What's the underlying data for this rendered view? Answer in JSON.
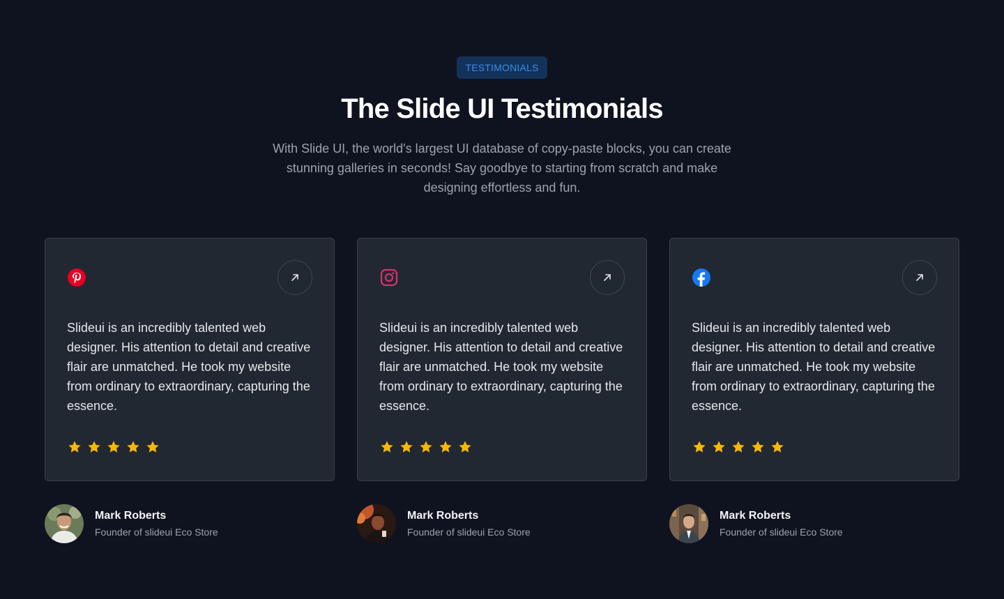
{
  "header": {
    "badge": "TESTIMONIALS",
    "title": "The Slide UI Testimonials",
    "subtitle": "With Slide UI, the world's largest UI database of copy-paste blocks, you can create stunning galleries in seconds! Say goodbye to starting from scratch and make designing effortless and fun."
  },
  "colors": {
    "background": "#0e131f",
    "card": "#222831",
    "star": "#f5b70b",
    "badge_bg": "#13325a",
    "badge_text": "#3b8bea"
  },
  "testimonials": [
    {
      "brand_icon": "pinterest-icon",
      "quote": "Slideui is an incredibly talented web designer. His attention to detail and creative flair are unmatched. He took my website from ordinary to extraordinary, capturing the essence.",
      "rating": 5,
      "author_name": "Mark Roberts",
      "author_role": "Founder of slideui Eco Store"
    },
    {
      "brand_icon": "instagram-icon",
      "quote": "Slideui is an incredibly talented web designer. His attention to detail and creative flair are unmatched. He took my website from ordinary to extraordinary, capturing the essence.",
      "rating": 5,
      "author_name": "Mark Roberts",
      "author_role": "Founder of slideui Eco Store"
    },
    {
      "brand_icon": "facebook-icon",
      "quote": "Slideui is an incredibly talented web designer. His attention to detail and creative flair are unmatched. He took my website from ordinary to extraordinary, capturing the essence.",
      "rating": 5,
      "author_name": "Mark Roberts",
      "author_role": "Founder of slideui Eco Store"
    }
  ]
}
